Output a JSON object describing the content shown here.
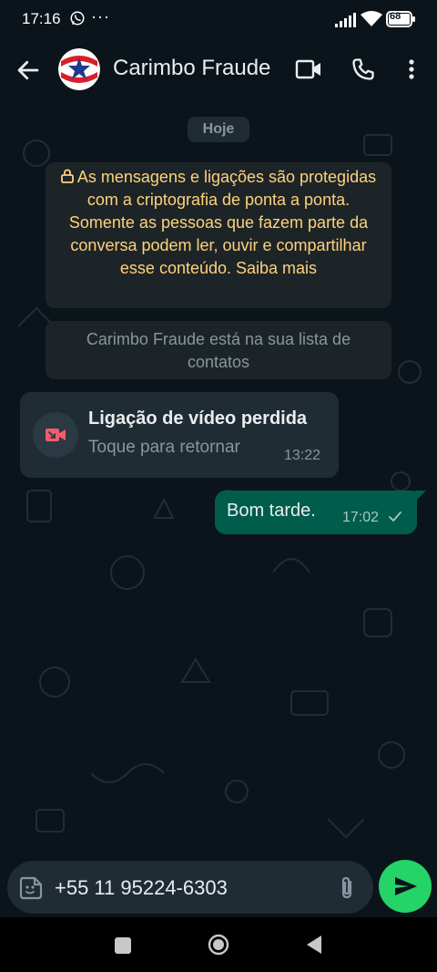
{
  "status_bar": {
    "time": "17:16",
    "more": "···",
    "battery": "68"
  },
  "header": {
    "contact_name": "Carimbo Fraude",
    "icons": [
      "back-arrow-icon",
      "video-call-icon",
      "voice-call-icon",
      "more-options-icon"
    ]
  },
  "chat": {
    "date_chip": "Hoje",
    "encryption_notice": "As mensagens e ligações são protegidas com a criptografia de ponta a ponta. Somente as pessoas que fazem parte da conversa podem ler, ouvir e compartilhar esse conteúdo. Saiba mais",
    "contact_notice": "Carimbo Fraude está na sua lista de contatos",
    "missed_call": {
      "title": "Ligação de vídeo perdida",
      "subtitle": "Toque para retornar",
      "time": "13:22"
    },
    "outgoing": {
      "text": "Bom tarde.",
      "time": "17:02",
      "status": "sent-check"
    }
  },
  "input_bar": {
    "value": "+55 11 95224-6303"
  },
  "colors": {
    "background": "#0b141a",
    "accent_green": "#25d366",
    "outgoing_bubble": "#005c4b",
    "incoming_bubble": "#202c33",
    "system_notice_text": "#ffd279",
    "missed_call_red": "#f15c6d"
  }
}
